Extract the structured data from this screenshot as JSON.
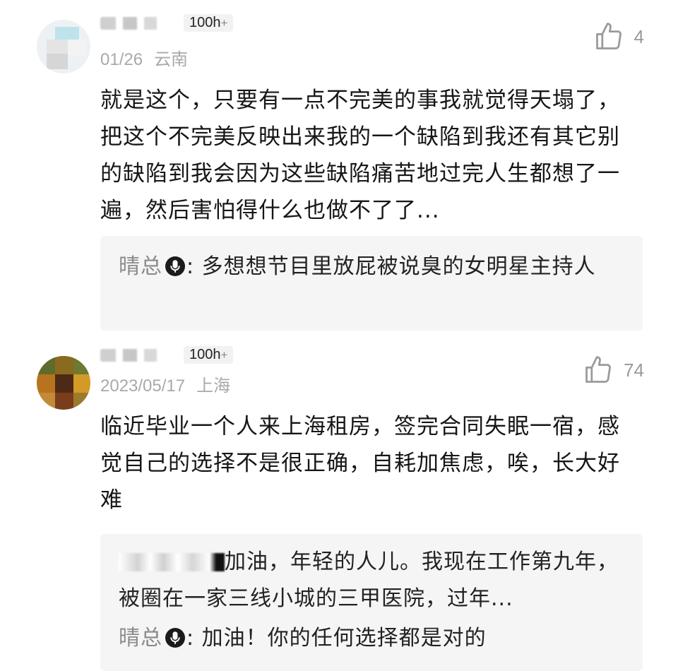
{
  "comments": [
    {
      "badge": "100h",
      "badge_plus": "+",
      "date": "01/26",
      "location": "云南",
      "likes": "4",
      "text": "就是这个，只要有一点不完美的事我就觉得天塌了，把这个不完美反映出来我的一个缺陷到我还有其它别的缺陷到我会因为这些缺陷痛苦地过完人生都想了一遍，然后害怕得什么也做不了了...",
      "replies": [
        {
          "author": "晴总",
          "text": ": 多想想节目里放屁被说臭的女明星主持人"
        }
      ]
    },
    {
      "badge": "100h",
      "badge_plus": "+",
      "date": "2023/05/17",
      "location": "上海",
      "likes": "74",
      "text": "临近毕业一个人来上海租房，签完合同失眠一宿，感觉自己的选择不是很正确，自耗加焦虑，唉，长大好难",
      "replies": [
        {
          "text": "加油，年轻的人儿。我现在工作第九年，被圈在一家三线小城的三甲医院，过年..."
        },
        {
          "author": "晴总",
          "text": ": 加油！你的任何选择都是对的"
        }
      ]
    }
  ],
  "icons": {
    "like": "thumbs-up-icon",
    "mic": "microphone-icon"
  },
  "colors": {
    "meta": "#a9a9a9",
    "reply_bg": "#f5f5f5",
    "author": "#8a8a8a"
  }
}
